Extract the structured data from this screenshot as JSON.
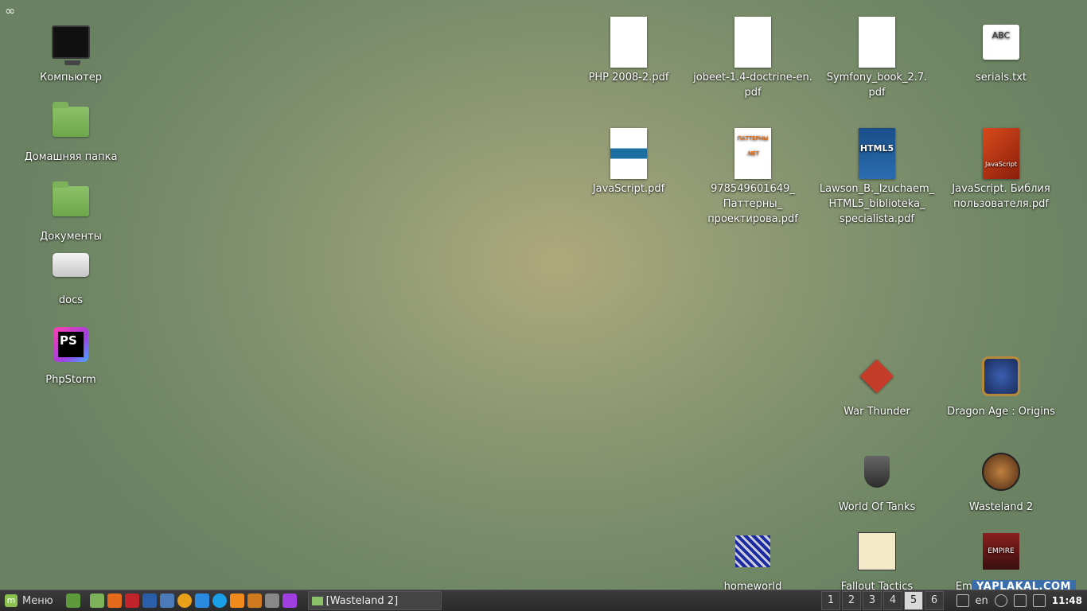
{
  "desktop": {
    "corner_glyph": "∞",
    "left_icons": [
      {
        "label": "Компьютер"
      },
      {
        "label": "Домашняя папка"
      },
      {
        "label": "Документы"
      },
      {
        "label": "docs"
      },
      {
        "label": "PhpStorm"
      }
    ],
    "files": [
      {
        "label": "PHP 2008-2.pdf"
      },
      {
        "label": "jobeet-1.4-doctrine-en.\npdf"
      },
      {
        "label": "Symfony_book_2.7.\npdf"
      },
      {
        "label": "serials.txt",
        "thumb": "ABC"
      },
      {
        "label": "JavaScript.pdf"
      },
      {
        "label": "978549601649_\nПаттерны_\nпроектирова.pdf",
        "thumb": "ПАТТЕРНЫ .NET"
      },
      {
        "label": "Lawson_B._Izuchaem_\nHTML5_biblioteka_\nspecialista.pdf",
        "thumb": "HTML5"
      },
      {
        "label": "JavaScript. Библия\nпользователя.pdf",
        "thumb": "JavaScript"
      }
    ],
    "games": [
      {
        "label": "War Thunder"
      },
      {
        "label": "Dragon Age : Origins"
      },
      {
        "label": "World Of Tanks"
      },
      {
        "label": "Wasteland 2"
      },
      {
        "label": "homeworld"
      },
      {
        "label": "Fallout Tactics"
      },
      {
        "label": "Empire: Total War",
        "thumb": "EMPIRE"
      }
    ]
  },
  "taskbar": {
    "menu_label": "Меню",
    "window_button": "[Wasteland 2]",
    "workspaces": [
      "1",
      "2",
      "3",
      "4",
      "5",
      "6"
    ],
    "active_workspace": "5",
    "keyboard_layout": "en",
    "clock": "11:48"
  },
  "watermark": "YAPLAKAL.COM",
  "colors": {
    "folder": "#7db25a",
    "taskbar": "#2f2f2f",
    "active_ws": "#d8d8d8"
  }
}
